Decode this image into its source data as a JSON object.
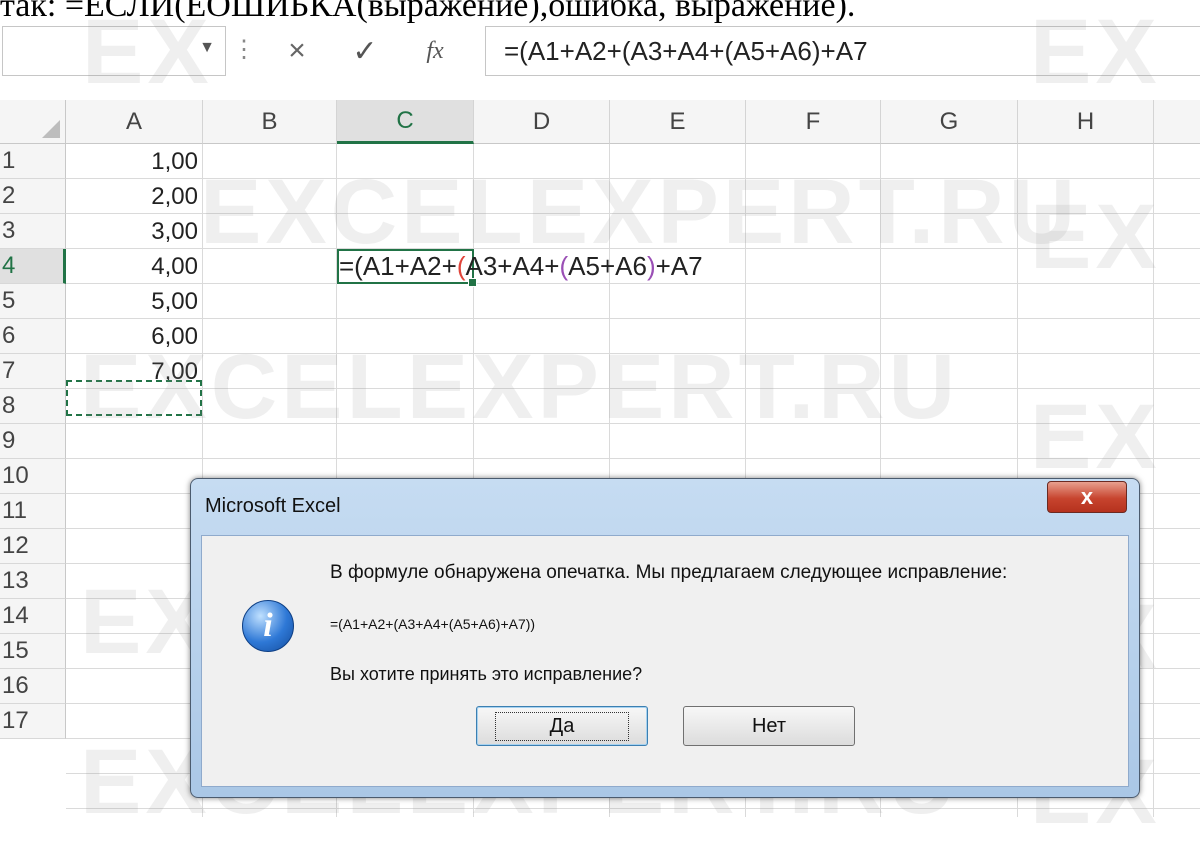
{
  "document": {
    "caption": "так: =ЕСЛИ(ЕОШИБКА(выражение),ошибка, выражение)."
  },
  "formula_bar": {
    "name_box_value": "",
    "separator_glyph": "⋮",
    "cancel_icon": "×",
    "enter_icon": "✓",
    "fx_label": "fx",
    "formula": "=(A1+A2+(A3+A4+(A5+A6)+A7"
  },
  "grid": {
    "columns": [
      "A",
      "B",
      "C",
      "D",
      "E",
      "F",
      "G",
      "H"
    ],
    "selected_column": "C",
    "rows": [
      "1",
      "2",
      "3",
      "4",
      "5",
      "6",
      "7",
      "8",
      "9",
      "10",
      "11",
      "12",
      "13",
      "14",
      "15",
      "16",
      "17"
    ],
    "selected_row": "4",
    "column_a_values": [
      "1,00",
      "2,00",
      "3,00",
      "4,00",
      "5,00",
      "6,00",
      "7,00"
    ],
    "editing_cell": "C4",
    "editing_text": {
      "part1": "=(A1+A2+",
      "paren1": "(",
      "part2": "A3+A4+",
      "paren2": "(",
      "part3": "A5+A6",
      "paren3": ")",
      "part4": "+A7"
    },
    "copy_marquee_cell": "A7"
  },
  "watermark": {
    "text_full": "EXCELEXPERT.RU",
    "text_short": "EX"
  },
  "dialog": {
    "title": "Microsoft Excel",
    "close_label": "x",
    "message": "В формуле обнаружена опечатка. Мы предлагаем следующее исправление:",
    "suggested_formula": "=(A1+A2+(A3+A4+(A5+A6)+A7))",
    "question": "Вы хотите принять это исправление?",
    "yes_label": "Да",
    "no_label": "Нет"
  },
  "colors": {
    "excel_green": "#217346",
    "paren_red": "#e0443a",
    "paren_purple": "#9a4fb5"
  }
}
